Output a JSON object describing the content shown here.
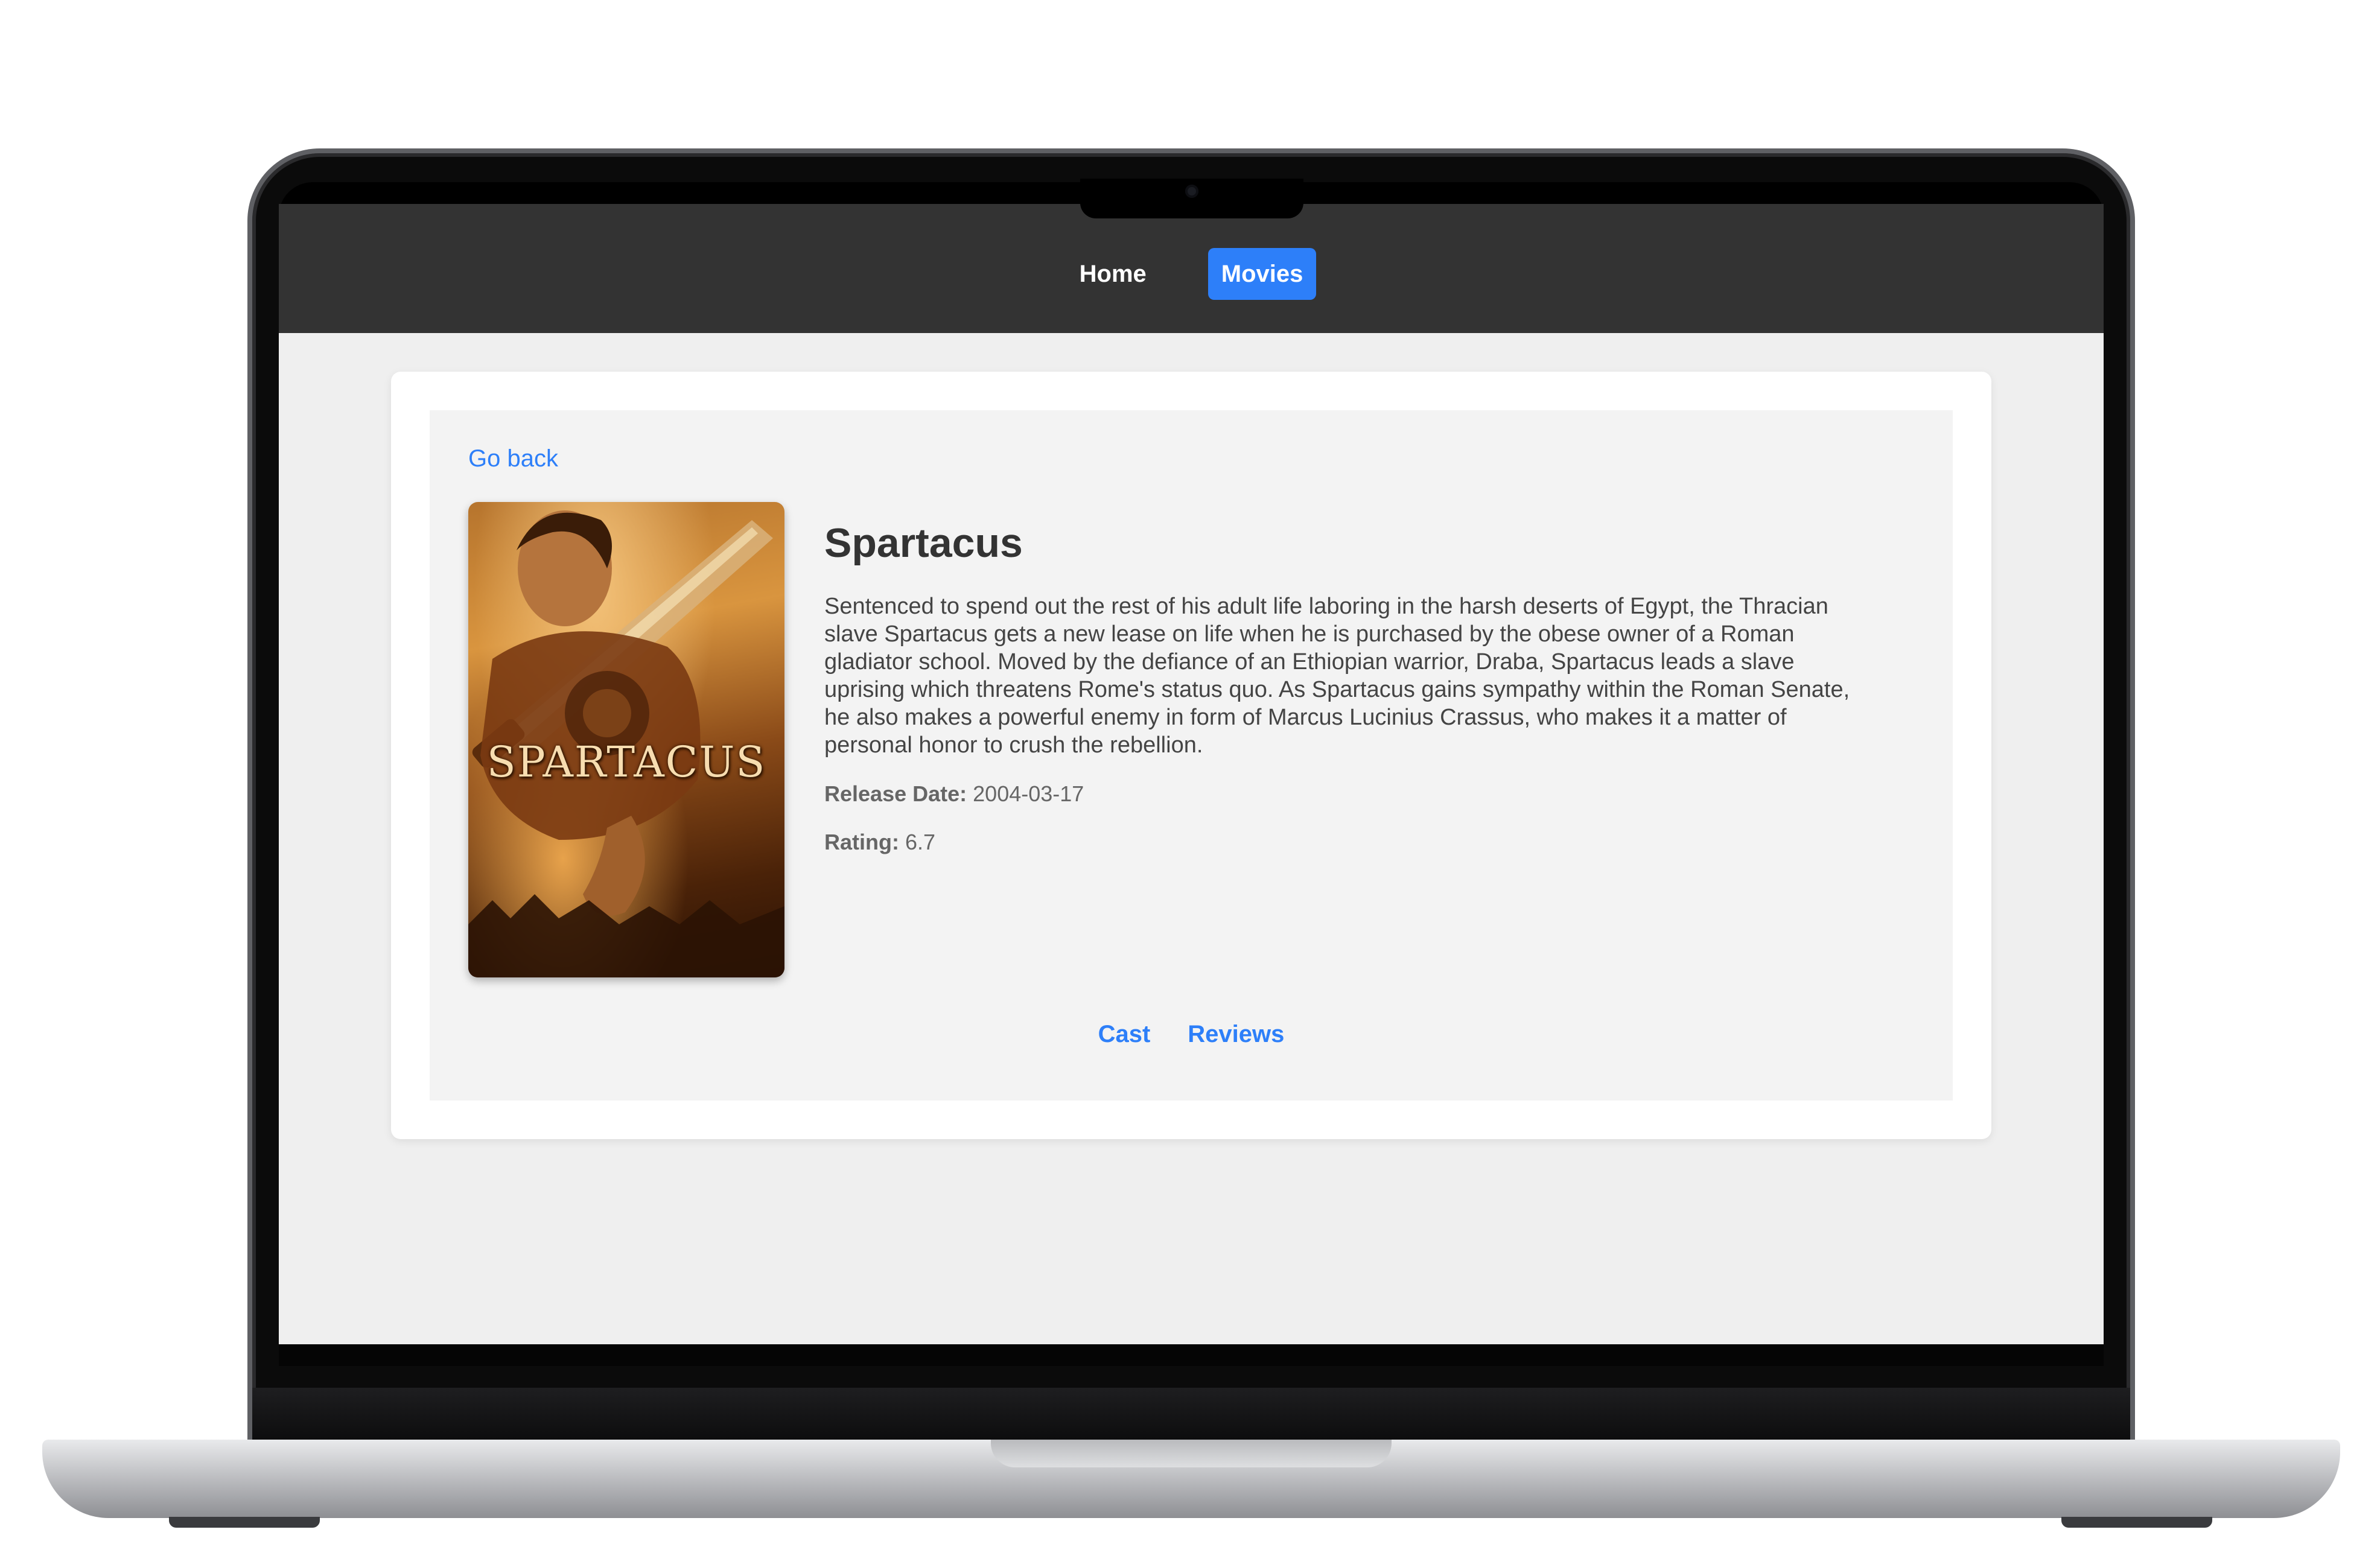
{
  "nav": {
    "items": [
      {
        "label": "Home",
        "active": false
      },
      {
        "label": "Movies",
        "active": true
      }
    ]
  },
  "movie": {
    "go_back_label": "Go back",
    "poster_text": "SPARTACUS",
    "title": "Spartacus",
    "overview": "Sentenced to spend out the rest of his adult life laboring in the harsh deserts of Egypt, the Thracian slave Spartacus gets a new lease on life when he is purchased by the obese owner of a Roman gladiator school. Moved by the defiance of an Ethiopian warrior, Draba, Spartacus leads a slave uprising which threatens Rome's status quo. As Spartacus gains sympathy within the Roman Senate, he also makes a powerful enemy in form of Marcus Lucinius Crassus, who makes it a matter of personal honor to crush the rebellion.",
    "release_label": "Release Date:",
    "release_date": "2004-03-17",
    "rating_label": "Rating:",
    "rating": "6.7"
  },
  "subnav": {
    "cast_label": "Cast",
    "reviews_label": "Reviews"
  },
  "colors": {
    "accent": "#2d7ff9",
    "navbar_bg": "#333333",
    "page_bg": "#efefef"
  }
}
